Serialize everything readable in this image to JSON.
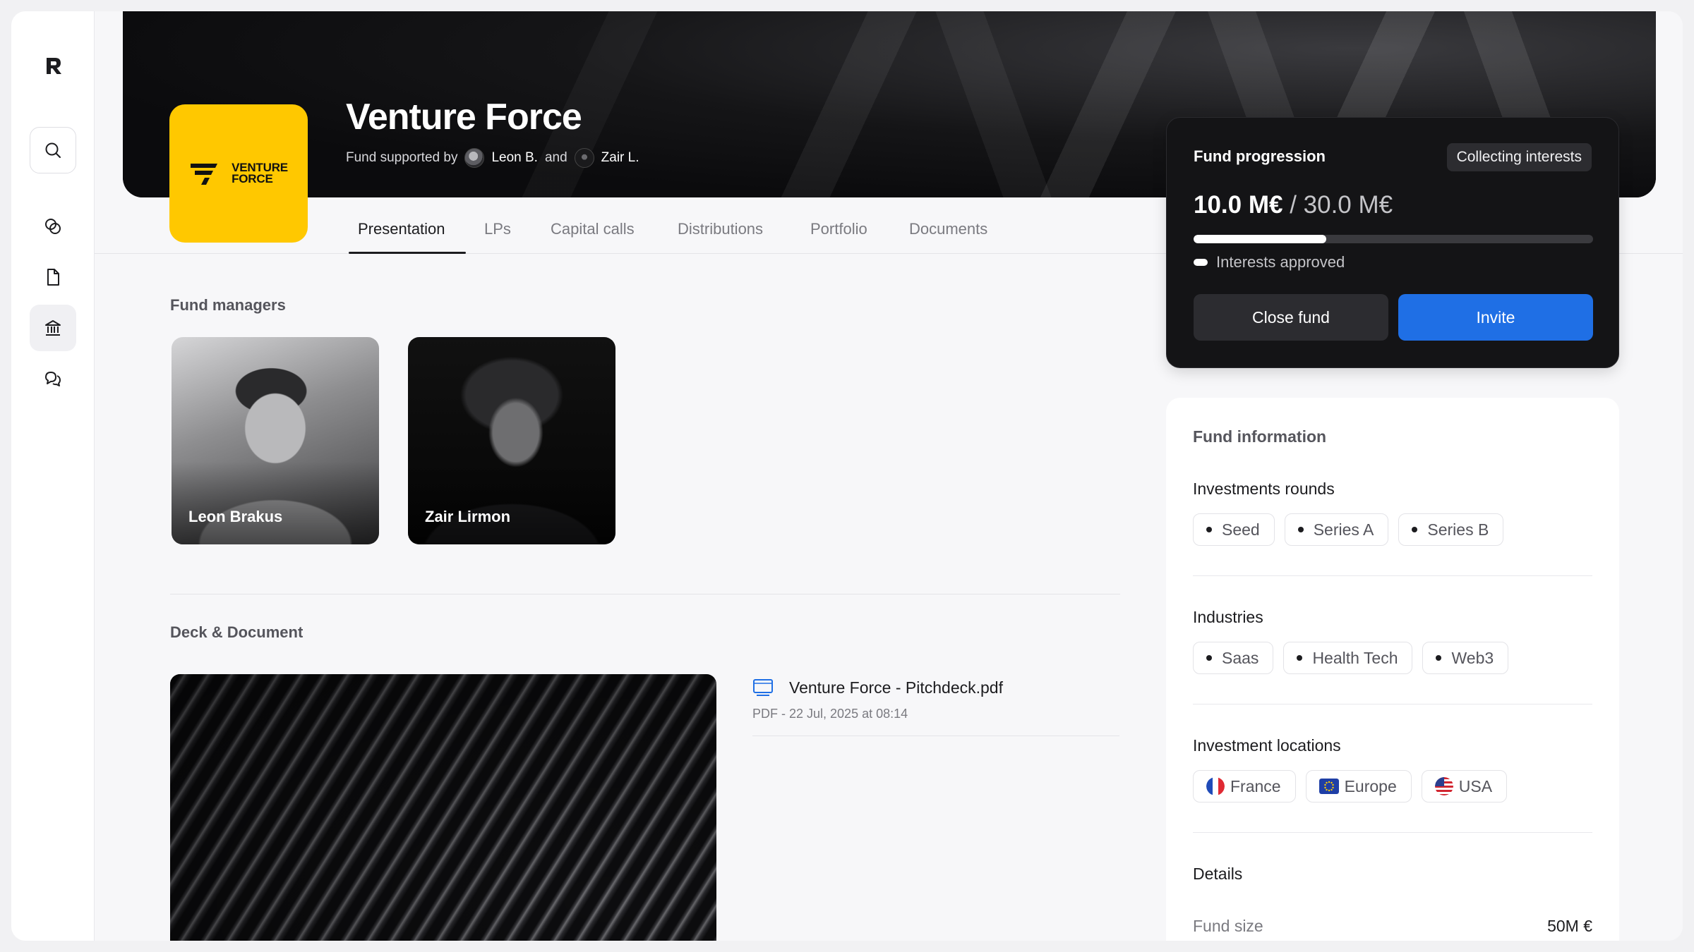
{
  "app": {
    "logo_letter": "R"
  },
  "sidebar": {
    "items": [
      {
        "name": "search",
        "icon": "search-icon"
      },
      {
        "name": "deals",
        "icon": "coins-icon"
      },
      {
        "name": "documents",
        "icon": "file-icon"
      },
      {
        "name": "funds",
        "icon": "bank-icon",
        "active": true
      },
      {
        "name": "messages",
        "icon": "chat-icon"
      }
    ]
  },
  "hero": {
    "title": "Venture Force",
    "logo_text_line1": "VENTURE",
    "logo_text_line2": "FORCE",
    "supported_prefix": "Fund supported by",
    "manager1_short": "Leon B.",
    "and_text": "and",
    "manager2_short": "Zair L."
  },
  "tabs": [
    {
      "label": "Presentation",
      "active": true
    },
    {
      "label": "LPs"
    },
    {
      "label": "Capital calls"
    },
    {
      "label": "Distributions"
    },
    {
      "label": "Portfolio"
    },
    {
      "label": "Documents"
    }
  ],
  "managers": {
    "section_title": "Fund managers",
    "items": [
      {
        "name": "Leon Brakus"
      },
      {
        "name": "Zair Lirmon"
      }
    ]
  },
  "deck": {
    "section_title": "Deck & Document",
    "file_name": "Venture Force - Pitchdeck.pdf",
    "file_meta": "PDF - 22 Jul, 2025 at 08:14"
  },
  "progression": {
    "title": "Fund progression",
    "status_badge": "Collecting interests",
    "raised": "10.0 M€",
    "separator": " / ",
    "target": "30.0 M€",
    "progress_fraction": 0.333,
    "legend": "Interests approved",
    "close_label": "Close fund",
    "invite_label": "Invite",
    "accent_color": "#1f6fe5"
  },
  "fund_info": {
    "title": "Fund information",
    "rounds_label": "Investments rounds",
    "rounds": [
      "Seed",
      "Series A",
      "Series B"
    ],
    "industries_label": "Industries",
    "industries": [
      "Saas",
      "Health Tech",
      "Web3"
    ],
    "locations_label": "Investment locations",
    "locations": [
      {
        "label": "France",
        "flag": "flag-france-icon"
      },
      {
        "label": "Europe",
        "flag": "flag-eu-icon"
      },
      {
        "label": "USA",
        "flag": "flag-usa-icon"
      }
    ],
    "details_label": "Details",
    "fund_size_key": "Fund size",
    "fund_size_value": "50M €"
  }
}
